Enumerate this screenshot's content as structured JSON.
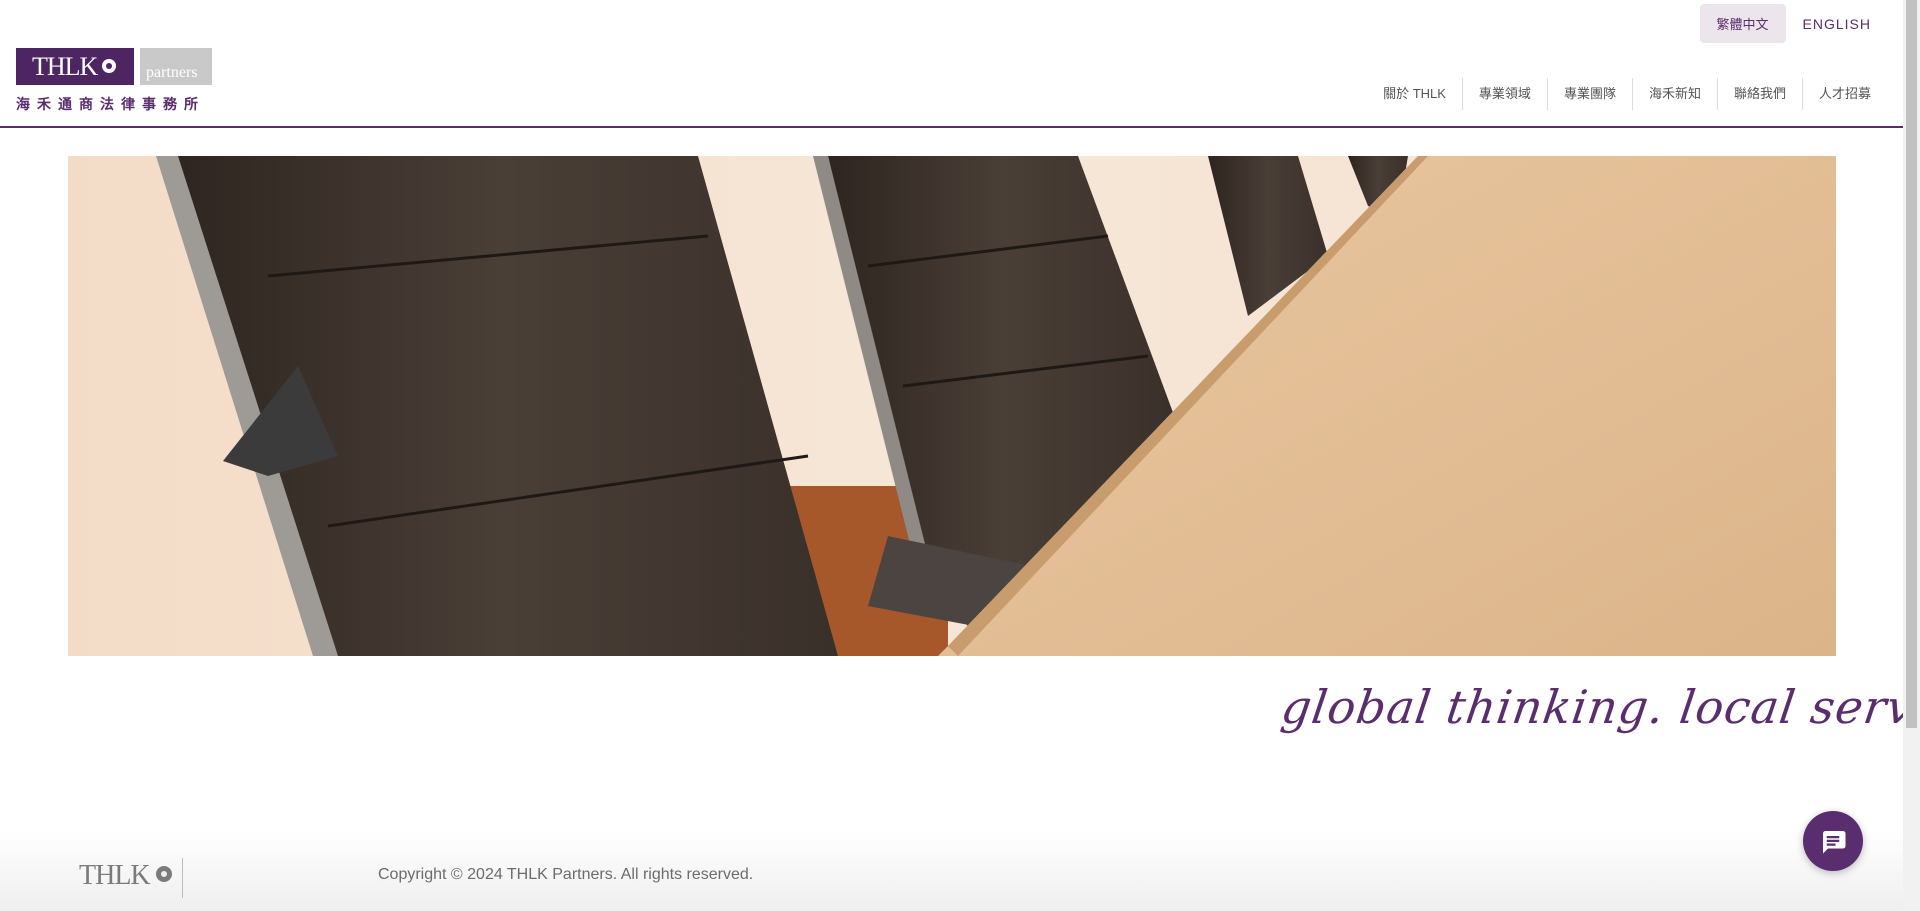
{
  "brand": {
    "logo_text": "THLK",
    "logo_partners": "partners",
    "logo_chinese": "海禾通商法律事務所"
  },
  "language": {
    "chinese": "繁體中文",
    "english": "ENGLISH"
  },
  "nav": {
    "items": [
      {
        "label": "關於 THLK"
      },
      {
        "label": "專業領域"
      },
      {
        "label": "專業團隊"
      },
      {
        "label": "海禾新知"
      },
      {
        "label": "聯絡我們"
      },
      {
        "label": "人才招募"
      }
    ]
  },
  "hero": {
    "tagline": "global thinking. local service."
  },
  "footer": {
    "logo_text": "THLK",
    "copyright": "Copyright © 2024 THLK Partners. All rights reserved."
  },
  "colors": {
    "brand_purple": "#5a2d6e",
    "logo_gray": "#c9c9c9"
  },
  "icons": {
    "chat": "chat-icon",
    "logo_mark": "logo-mark-icon"
  }
}
